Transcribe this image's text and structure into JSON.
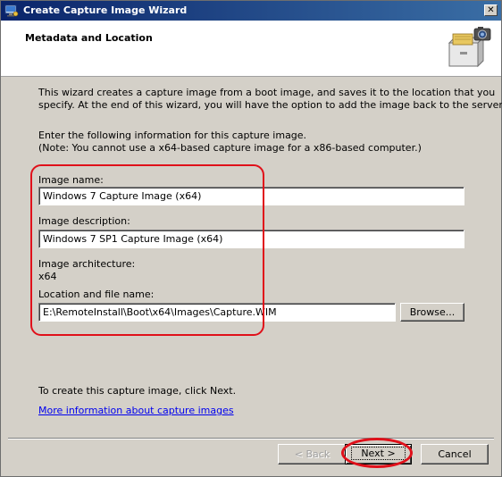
{
  "window": {
    "title": "Create Capture Image Wizard",
    "close_label": "✕"
  },
  "header": {
    "title": "Metadata and Location"
  },
  "intro": {
    "line1": "This wizard creates a capture image from a boot image, and saves it to the location that you",
    "line2": "specify. At the end of this wizard, you will have the option to add the image back to the server."
  },
  "instructions": {
    "line1": "Enter the following information for this capture image.",
    "line2": "(Note: You cannot use a x64-based capture image for a x86-based computer.)"
  },
  "form": {
    "image_name_label": "Image name:",
    "image_name_value": "Windows 7 Capture Image (x64)",
    "image_description_label": "Image description:",
    "image_description_value": "Windows 7 SP1 Capture Image (x64)",
    "architecture_label": "Image architecture:",
    "architecture_value": "x64",
    "location_label": "Location and file name:",
    "location_value": "E:\\RemoteInstall\\Boot\\x64\\Images\\Capture.WIM",
    "browse_label": "Browse..."
  },
  "footer": {
    "create_hint": "To create this capture image, click Next.",
    "more_info_link": "More information about capture images"
  },
  "buttons": {
    "back_label": "< Back",
    "next_label": "Next >",
    "cancel_label": "Cancel"
  },
  "colors": {
    "highlight_annotation": "#e0101a",
    "link": "#0000ee",
    "title_bar": "#0a246a"
  }
}
